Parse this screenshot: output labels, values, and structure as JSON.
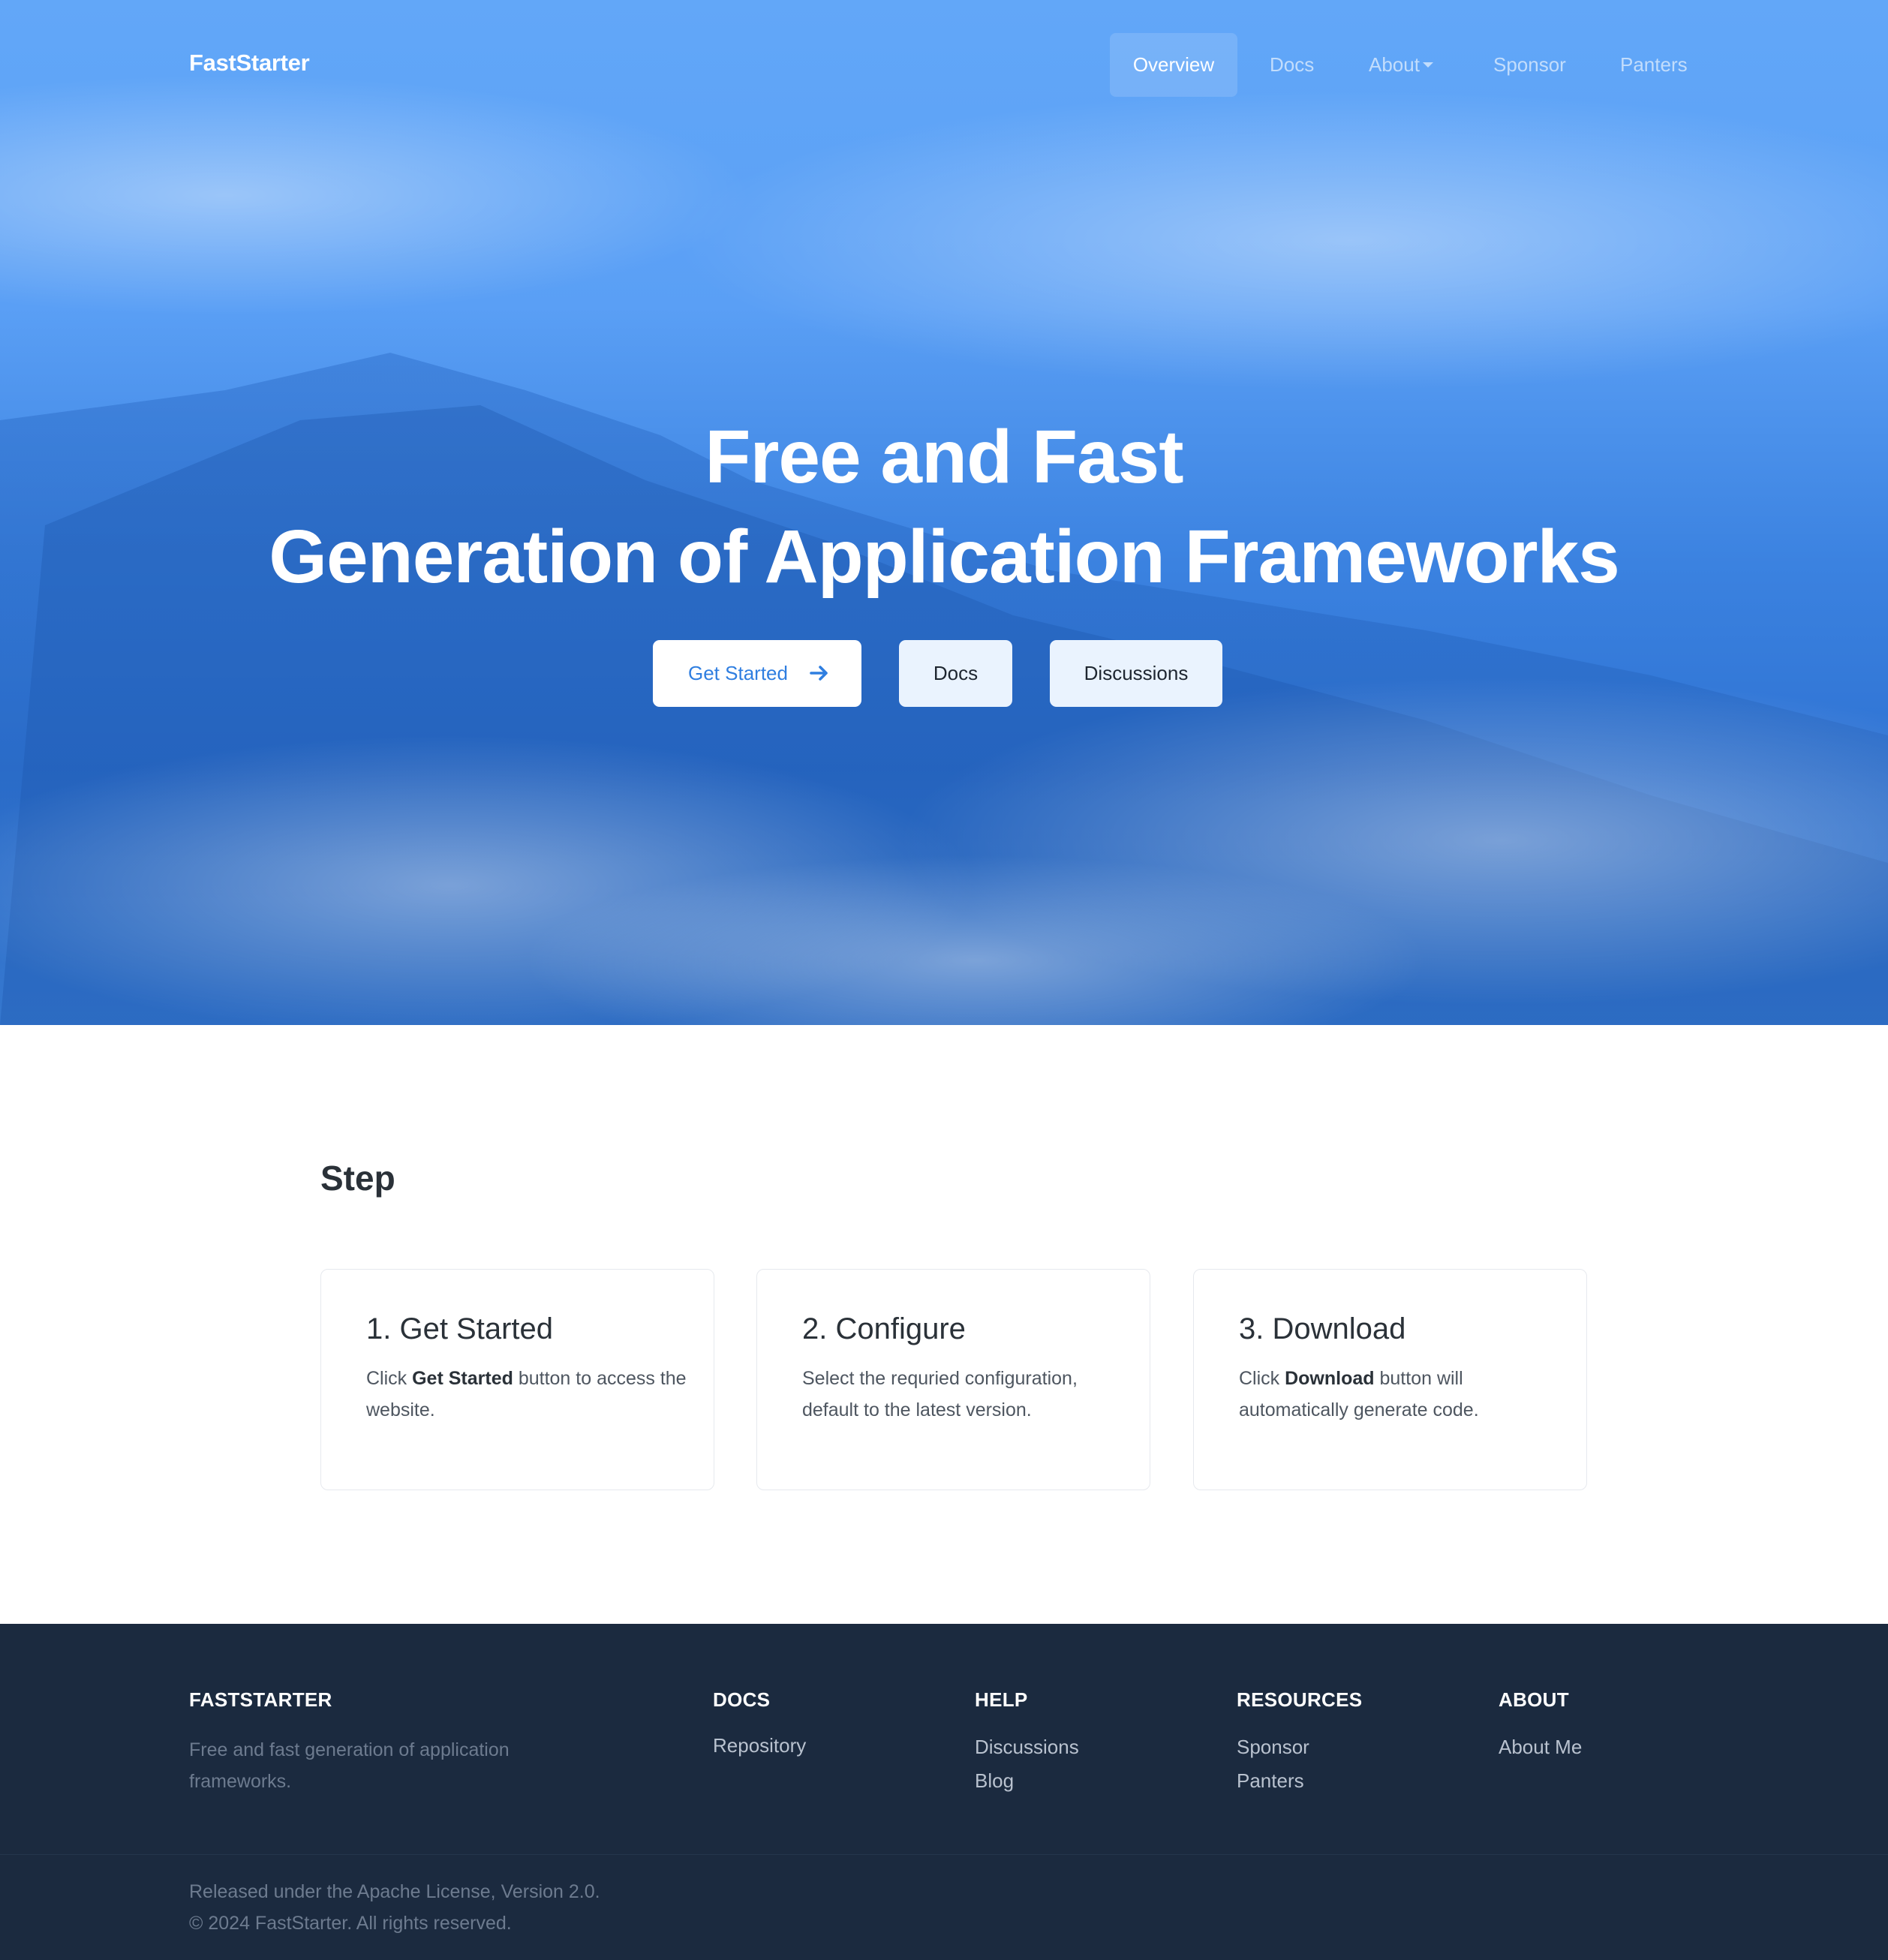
{
  "nav": {
    "brand": "FastStarter",
    "items": [
      {
        "label": "Overview"
      },
      {
        "label": "Docs"
      },
      {
        "label": "About"
      },
      {
        "label": "Sponsor"
      },
      {
        "label": "Panters"
      }
    ]
  },
  "hero": {
    "title_line1": "Free and Fast",
    "title_line2": "Generation of Application Frameworks",
    "buttons": {
      "get_started": "Get Started",
      "docs": "Docs",
      "discussions": "Discussions"
    }
  },
  "steps": {
    "title": "Step",
    "cards": [
      {
        "title": "1. Get Started",
        "text_before": "Click ",
        "text_bold": "Get Started",
        "text_after": " button to access the website."
      },
      {
        "title": "2. Configure",
        "text": "Select the requried configuration, default to the latest version."
      },
      {
        "title": "3. Download",
        "text_before": "Click ",
        "text_bold": "Download",
        "text_after": " button will automatically generate code."
      }
    ]
  },
  "footer": {
    "brand_heading": "FASTSTARTER",
    "brand_desc": "Free and fast generation of application frameworks.",
    "columns": [
      {
        "heading": "DOCS",
        "links": [
          "Repository"
        ]
      },
      {
        "heading": "HELP",
        "links": [
          "Discussions",
          "Blog"
        ]
      },
      {
        "heading": "RESOURCES",
        "links": [
          "Sponsor",
          "Panters"
        ]
      },
      {
        "heading": "ABOUT",
        "links": [
          "About Me"
        ]
      }
    ],
    "license": "Released under the Apache License, Version 2.0.",
    "copyright": "© 2024 FastStarter. All rights reserved."
  },
  "colors": {
    "hero_blue": "#5a9ff5",
    "accent": "#2f7ee0",
    "footer_bg": "#1b2a3f",
    "button_light": "#eaf3fe"
  },
  "icons": {
    "get_started_arrow": "arrow-right-icon",
    "about_dropdown": "caret-down-icon"
  }
}
